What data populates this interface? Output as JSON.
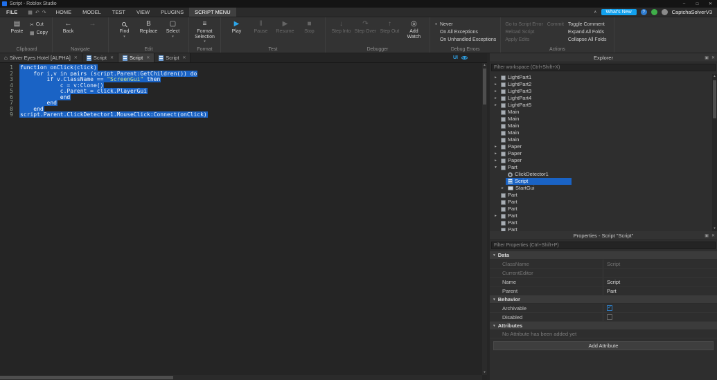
{
  "colors": {
    "selection_blue": "#1a63c5",
    "whats_new_blue": "#12a1ee",
    "panel_bg": "#2e2e2e",
    "editor_bg": "#252525"
  },
  "titlebar": {
    "title": "Script - Roblox Studio"
  },
  "menubar": {
    "file_label": "FILE",
    "quick_icons": [
      "save-icon",
      "undo-icon",
      "redo-icon"
    ],
    "tabs": [
      {
        "label": "HOME"
      },
      {
        "label": "MODEL"
      },
      {
        "label": "TEST"
      },
      {
        "label": "VIEW"
      },
      {
        "label": "PLUGINS"
      },
      {
        "label": "SCRIPT MENU",
        "active": true
      }
    ],
    "whats_new_label": "What's New",
    "account_name": "CaptchaSolverV3"
  },
  "ribbon": {
    "groups": [
      {
        "label": "Clipboard",
        "items": [
          {
            "type": "big",
            "label": "Paste",
            "icon": "paste-icon"
          },
          {
            "type": "smallcol",
            "buttons": [
              {
                "label": "Cut",
                "icon": "cut-icon"
              },
              {
                "label": "Copy",
                "icon": "copy-icon"
              }
            ]
          }
        ]
      },
      {
        "label": "Navigate",
        "items": [
          {
            "type": "big",
            "label": "Back",
            "icon": "back-icon"
          },
          {
            "type": "big",
            "label": "",
            "icon": "forward-icon",
            "enabled": false
          }
        ]
      },
      {
        "label": "Edit",
        "items": [
          {
            "type": "big",
            "label": "Find",
            "icon": "find-icon",
            "menu": true
          },
          {
            "type": "big",
            "label": "Replace",
            "icon": "replace-icon"
          },
          {
            "type": "big",
            "label": "Select",
            "icon": "select-icon",
            "menu": true
          }
        ]
      },
      {
        "label": "Format",
        "items": [
          {
            "type": "big",
            "label": "Format Selection",
            "icon": "format-icon",
            "menu": true
          }
        ]
      },
      {
        "label": "Test",
        "items": [
          {
            "type": "big",
            "label": "Play",
            "icon": "play-icon",
            "accent": true
          },
          {
            "type": "big",
            "label": "Pause",
            "icon": "pause-icon",
            "enabled": false
          },
          {
            "type": "big",
            "label": "Resume",
            "icon": "resume-icon",
            "enabled": false
          },
          {
            "type": "big",
            "label": "Stop",
            "icon": "stop-icon",
            "enabled": false
          }
        ]
      },
      {
        "label": "Debugger",
        "items": [
          {
            "type": "big",
            "label": "Step Into",
            "icon": "step-into-icon",
            "enabled": false
          },
          {
            "type": "big",
            "label": "Step Over",
            "icon": "step-over-icon",
            "enabled": false
          },
          {
            "type": "big",
            "label": "Step Out",
            "icon": "step-out-icon",
            "enabled": false
          },
          {
            "type": "big",
            "label": "Add Watch",
            "icon": "add-watch-icon"
          }
        ]
      },
      {
        "label": "Debug Errors",
        "items": [
          {
            "type": "radiocol",
            "options": [
              {
                "label": "Never",
                "selected": true
              },
              {
                "label": "On All Exceptions"
              },
              {
                "label": "On Unhandled Exceptions"
              }
            ]
          }
        ]
      },
      {
        "label": "Actions",
        "items": [
          {
            "type": "menucol",
            "enabled": false,
            "entries": [
              "Go to Script Error",
              "Reload Script",
              "Apply Edits"
            ]
          },
          {
            "type": "menucol",
            "enabled": false,
            "entries": [
              "Commit"
            ]
          },
          {
            "type": "menucol",
            "enabled": true,
            "entries": [
              "Toggle Comment",
              "Expand All Folds",
              "Collapse All Folds"
            ]
          }
        ]
      }
    ]
  },
  "editor": {
    "tabs": [
      {
        "label": "Silver Eyes Hotel [ALPHA]",
        "icon": "home-icon",
        "active": false
      },
      {
        "label": "Script",
        "icon": "script-icon",
        "active": false
      },
      {
        "label": "Script",
        "icon": "script-icon",
        "active": true
      },
      {
        "label": "Script",
        "icon": "script-icon",
        "active": false
      }
    ],
    "ui_toggle_label": "UI",
    "lines": [
      {
        "n": 1,
        "code": "function onClick(click)"
      },
      {
        "n": 2,
        "code": "    for i,v in pairs (script.Parent:GetChildren()) do"
      },
      {
        "n": 3,
        "code": "        if v.ClassName == \"ScreenGui\" then"
      },
      {
        "n": 4,
        "code": "            c = v:Clone()"
      },
      {
        "n": 5,
        "code": "            c.Parent = click.PlayerGui"
      },
      {
        "n": 6,
        "code": "            end"
      },
      {
        "n": 7,
        "code": "        end"
      },
      {
        "n": 8,
        "code": "    end"
      },
      {
        "n": 9,
        "code": "script.Parent.ClickDetector1.MouseClick:Connect(onClick)"
      }
    ]
  },
  "explorer": {
    "title": "Explorer",
    "filter_placeholder": "Filter workspace (Ctrl+Shift+X)",
    "items": [
      {
        "label": "LightPart1",
        "depth": 1,
        "chevron": "right",
        "icon": "part-icon"
      },
      {
        "label": "LightPart2",
        "depth": 1,
        "chevron": "right",
        "icon": "part-icon"
      },
      {
        "label": "LightPart3",
        "depth": 1,
        "chevron": "right",
        "icon": "part-icon"
      },
      {
        "label": "LightPart4",
        "depth": 1,
        "chevron": "right",
        "icon": "part-icon"
      },
      {
        "label": "LightPart5",
        "depth": 1,
        "chevron": "right",
        "icon": "part-icon"
      },
      {
        "label": "Main",
        "depth": 1,
        "chevron": "none",
        "icon": "part-icon"
      },
      {
        "label": "Main",
        "depth": 1,
        "chevron": "none",
        "icon": "part-icon"
      },
      {
        "label": "Main",
        "depth": 1,
        "chevron": "none",
        "icon": "part-icon"
      },
      {
        "label": "Main",
        "depth": 1,
        "chevron": "none",
        "icon": "part-icon"
      },
      {
        "label": "Main",
        "depth": 1,
        "chevron": "none",
        "icon": "part-icon"
      },
      {
        "label": "Paper",
        "depth": 1,
        "chevron": "right",
        "icon": "part-icon"
      },
      {
        "label": "Paper",
        "depth": 1,
        "chevron": "right",
        "icon": "part-icon"
      },
      {
        "label": "Paper",
        "depth": 1,
        "chevron": "right",
        "icon": "part-icon"
      },
      {
        "label": "Part",
        "depth": 1,
        "chevron": "down",
        "icon": "part-icon"
      },
      {
        "label": "ClickDetector1",
        "depth": 2,
        "chevron": "none",
        "icon": "detector-icon"
      },
      {
        "label": "Script",
        "depth": 2,
        "chevron": "none",
        "icon": "script-icon",
        "selected": true
      },
      {
        "label": "StartGui",
        "depth": 2,
        "chevron": "right",
        "icon": "gui-icon"
      },
      {
        "label": "Part",
        "depth": 1,
        "chevron": "none",
        "icon": "part-icon"
      },
      {
        "label": "Part",
        "depth": 1,
        "chevron": "none",
        "icon": "part-icon"
      },
      {
        "label": "Part",
        "depth": 1,
        "chevron": "none",
        "icon": "part-icon"
      },
      {
        "label": "Part",
        "depth": 1,
        "chevron": "right",
        "icon": "part-icon"
      },
      {
        "label": "Part",
        "depth": 1,
        "chevron": "none",
        "icon": "part-icon"
      },
      {
        "label": "Part",
        "depth": 1,
        "chevron": "none",
        "icon": "part-icon"
      }
    ]
  },
  "properties": {
    "title": "Properties - Script \"Script\"",
    "filter_placeholder": "Filter Properties (Ctrl+Shift+P)",
    "sections": [
      {
        "label": "Data",
        "rows": [
          {
            "name": "ClassName",
            "value": "Script",
            "disabled": true
          },
          {
            "name": "CurrentEditor",
            "value": "",
            "disabled": true
          },
          {
            "name": "Name",
            "value": "Script"
          },
          {
            "name": "Parent",
            "value": "Part"
          }
        ]
      },
      {
        "label": "Behavior",
        "rows": [
          {
            "name": "Archivable",
            "checkbox": true,
            "checked": true
          },
          {
            "name": "Disabled",
            "checkbox": true,
            "checked": false
          }
        ]
      },
      {
        "label": "Attributes",
        "rows": [],
        "note": "No Attribute has been added yet"
      }
    ],
    "add_attribute_label": "Add Attribute"
  }
}
